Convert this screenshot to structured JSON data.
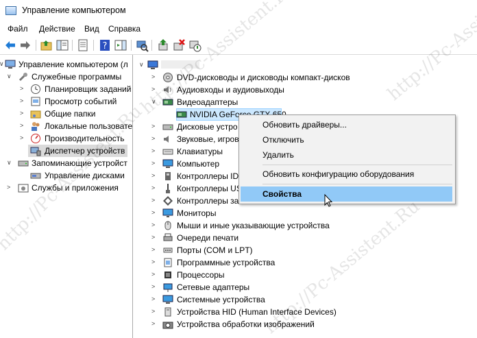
{
  "window": {
    "title": "Управление компьютером"
  },
  "menubar": [
    "Файл",
    "Действие",
    "Вид",
    "Справка"
  ],
  "toolbar": {
    "buttons": [
      "back-icon",
      "forward-icon",
      "up-folder-icon",
      "show-tree-icon",
      "properties-page-icon",
      "help-icon",
      "action-pane-icon",
      "device-scan-icon",
      "update-driver-icon",
      "uninstall-device-icon",
      "enable-device-icon"
    ]
  },
  "left_tree": [
    {
      "label": "Управление компьютером (л",
      "icon": "computer-management-icon",
      "exp": "∨"
    },
    {
      "label": "Служебные программы",
      "icon": "tools-icon",
      "exp": "∨"
    },
    {
      "label": "Планировщик заданий",
      "icon": "clock-icon",
      "exp": ">"
    },
    {
      "label": "Просмотр событий",
      "icon": "event-viewer-icon",
      "exp": ">"
    },
    {
      "label": "Общие папки",
      "icon": "shared-folder-icon",
      "exp": ">"
    },
    {
      "label": "Локальные пользовате",
      "icon": "users-icon",
      "exp": ">"
    },
    {
      "label": "Производительность",
      "icon": "performance-icon",
      "exp": ">"
    },
    {
      "label": "Диспетчер устройств",
      "icon": "device-manager-icon",
      "exp": ""
    },
    {
      "label": "Запоминающие устройст",
      "icon": "storage-icon",
      "exp": "∨"
    },
    {
      "label": "Управление дисками",
      "icon": "disk-management-icon",
      "exp": ""
    },
    {
      "label": "Службы и приложения",
      "icon": "services-icon",
      "exp": ">"
    }
  ],
  "device_tree": {
    "root_label": "",
    "items": [
      {
        "label": "DVD-дисководы и дисководы компакт-дисков",
        "icon": "dvd-icon",
        "exp": ">"
      },
      {
        "label": "Аудиовходы и аудиовыходы",
        "icon": "speaker-icon",
        "exp": ">"
      },
      {
        "label": "Видеоадаптеры",
        "icon": "display-adapter-icon",
        "exp": "∨"
      },
      {
        "label": "NVIDIA GeForce GTX 650",
        "icon": "display-adapter-icon",
        "exp": ""
      },
      {
        "label": "Дисковые устро",
        "icon": "disk-icon",
        "exp": ">"
      },
      {
        "label": "Звуковые, игров",
        "icon": "sound-icon",
        "exp": ">"
      },
      {
        "label": "Клавиатуры",
        "icon": "keyboard-icon",
        "exp": ">"
      },
      {
        "label": "Компьютер",
        "icon": "computer-icon",
        "exp": ">"
      },
      {
        "label": "Контроллеры ID",
        "icon": "ide-controller-icon",
        "exp": ">"
      },
      {
        "label": "Контроллеры US",
        "icon": "usb-icon",
        "exp": ">"
      },
      {
        "label": "Контроллеры за",
        "icon": "storage-controller-icon",
        "exp": ">"
      },
      {
        "label": "Мониторы",
        "icon": "monitor-icon",
        "exp": ">"
      },
      {
        "label": "Мыши и иные указывающие устройства",
        "icon": "mouse-icon",
        "exp": ">"
      },
      {
        "label": "Очереди печати",
        "icon": "printer-icon",
        "exp": ">"
      },
      {
        "label": "Порты (COM и LPT)",
        "icon": "port-icon",
        "exp": ">"
      },
      {
        "label": "Программные устройства",
        "icon": "software-device-icon",
        "exp": ">"
      },
      {
        "label": "Процессоры",
        "icon": "cpu-icon",
        "exp": ">"
      },
      {
        "label": "Сетевые адаптеры",
        "icon": "network-icon",
        "exp": ">"
      },
      {
        "label": "Системные устройства",
        "icon": "system-device-icon",
        "exp": ">"
      },
      {
        "label": "Устройства HID (Human Interface Devices)",
        "icon": "hid-icon",
        "exp": ">"
      },
      {
        "label": "Устройства обработки изображений",
        "icon": "camera-icon",
        "exp": ">"
      }
    ]
  },
  "context_menu": {
    "items": [
      "Обновить драйверы...",
      "Отключить",
      "Удалить",
      "Обновить конфигурацию оборудования",
      "Свойства"
    ],
    "highlighted": "Свойства"
  },
  "watermark": "http://Pc-Assistent.Ru",
  "colors": {
    "highlight": "#91c9f7",
    "selection": "#dadada",
    "menu_bg": "#f2f2f2"
  }
}
